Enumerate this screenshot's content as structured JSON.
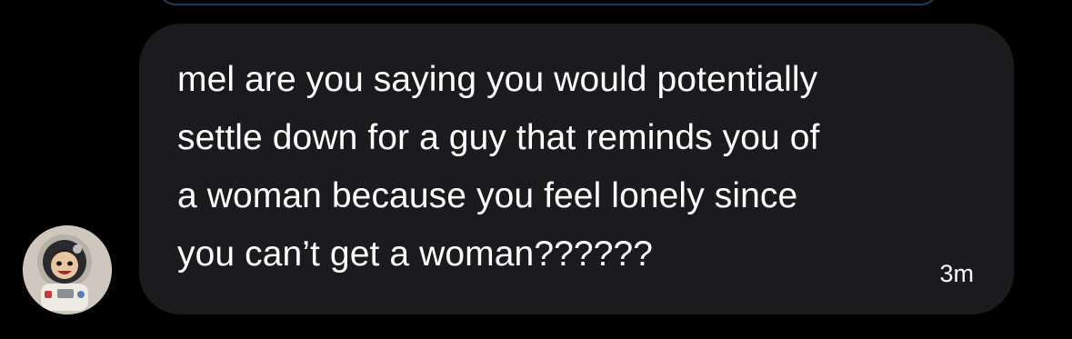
{
  "conversation": {
    "message": {
      "text": "mel are you saying you would potentially\nsettle down for a guy that reminds you of\na woman because you feel lonely since\nyou can’t get a woman??????",
      "timestamp": "3m"
    },
    "sender": {
      "avatar_icon": "astronaut-character-avatar"
    }
  },
  "colors": {
    "background": "#000000",
    "bubble": "#1b1b1d",
    "text": "#ffffff",
    "previous_bubble_border": "#1d3f5e"
  }
}
